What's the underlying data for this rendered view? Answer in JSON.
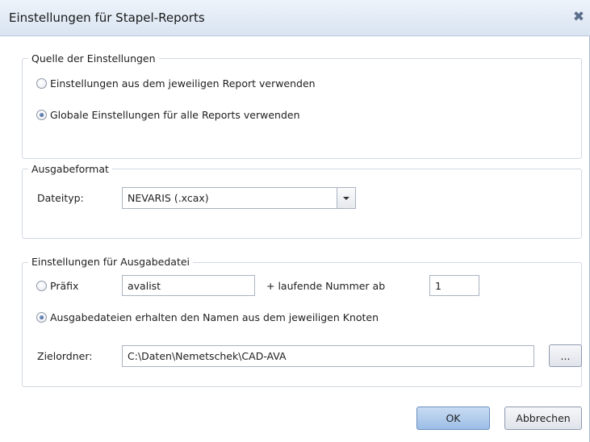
{
  "dialog": {
    "title": "Einstellungen für Stapel-Reports",
    "close_icon": "close-icon"
  },
  "source": {
    "group_title": "Quelle der Einstellungen",
    "option_report": "Einstellungen aus dem jeweiligen Report verwenden",
    "option_global": "Globale Einstellungen für alle Reports verwenden",
    "selected": "global"
  },
  "format": {
    "group_title": "Ausgabeformat",
    "filetype_label": "Dateityp:",
    "filetype_value": "NEVARIS (.xcax)"
  },
  "output": {
    "group_title": "Einstellungen für Ausgabedatei",
    "prefix_label": "Präfix",
    "prefix_value": "avalist",
    "running_number_label": "+ laufende Nummer ab",
    "running_number_value": "1",
    "option_node_name": "Ausgabedateien erhalten den Namen aus dem jeweiligen Knoten",
    "selected": "node_name",
    "target_folder_label": "Zielordner:",
    "target_folder_value": "C:\\Daten\\Nemetschek\\CAD-AVA",
    "browse_label": "..."
  },
  "buttons": {
    "ok": "OK",
    "cancel": "Abbrechen"
  }
}
